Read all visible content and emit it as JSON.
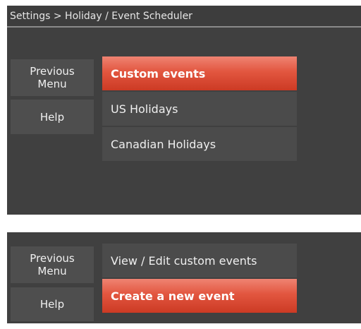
{
  "screen_one": {
    "breadcrumb": "Settings > Holiday / Event Scheduler",
    "side_buttons": {
      "previous_menu": [
        "Previous",
        "Menu"
      ],
      "help": "Help"
    },
    "menu": [
      {
        "label": "Custom events",
        "selected": true
      },
      {
        "label": "US Holidays",
        "selected": false
      },
      {
        "label": "Canadian Holidays",
        "selected": false
      }
    ]
  },
  "screen_two": {
    "side_buttons": {
      "previous_menu": [
        "Previous",
        "Menu"
      ],
      "help": "Help"
    },
    "menu": [
      {
        "label": "View / Edit custom events",
        "selected": false
      },
      {
        "label": "Create a new event",
        "selected": true
      }
    ]
  },
  "colors": {
    "panel_background": "#404040",
    "button_background": "#4e4e4e",
    "selected_accent": "#e2563f",
    "text": "#efefef"
  }
}
